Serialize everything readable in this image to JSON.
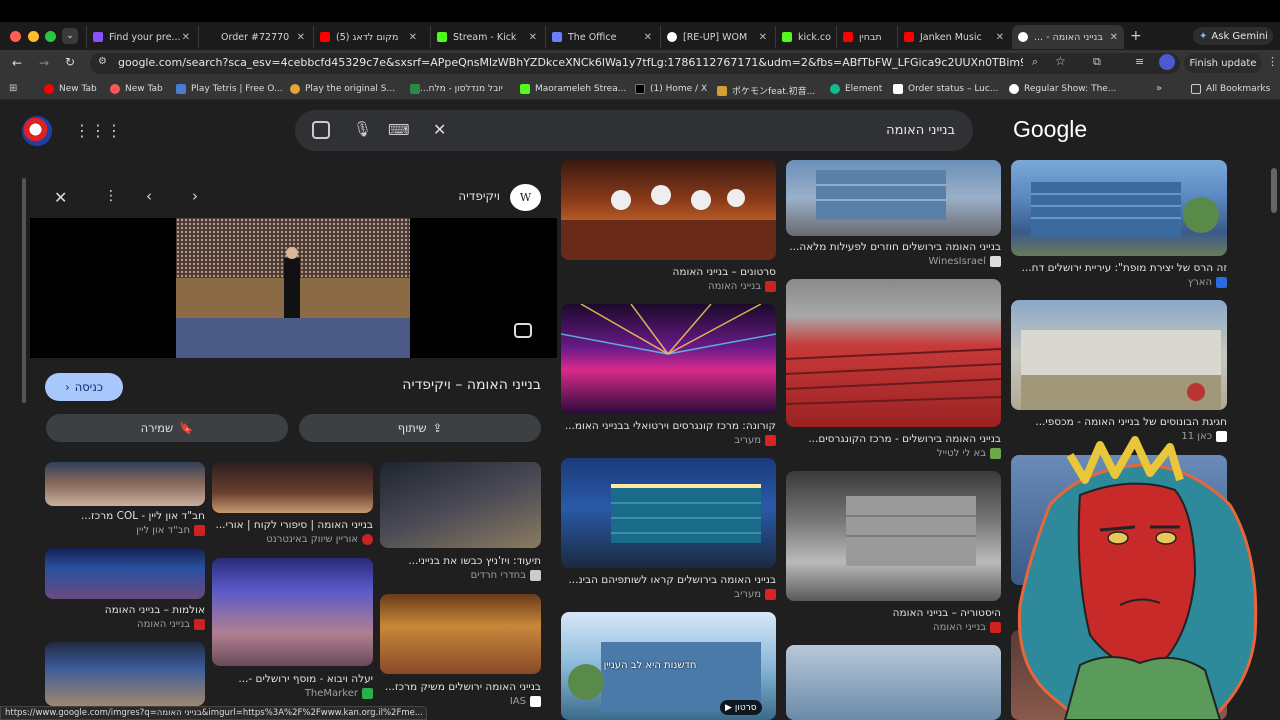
{
  "tabs": [
    {
      "label": "Find your pre..."
    },
    {
      "label": "Order #72770"
    },
    {
      "label": "(5) מקום לדאג"
    },
    {
      "label": "Stream - Kick"
    },
    {
      "label": "The Office"
    },
    {
      "label": "[RE-UP] WOM"
    },
    {
      "label": "kick.co"
    },
    {
      "label": "תבחין"
    },
    {
      "label": "Janken Music"
    },
    {
      "label": "בנייני האומה - ..."
    }
  ],
  "ask_gemini": "Ask Gemini",
  "url": "google.com/search?sca_esv=4cebbcfd45329c7e&sxsrf=APpeQnsMlzWBhYZDkceXNCk6lWa1y7tfLg:1786112767171&udm=2&fbs=ABfTbFW_LFGica9c2UUXn0TBim9XFWDbOu-YW...",
  "finish_update": "Finish update",
  "bookmarks": [
    "New Tab",
    "New Tab",
    "Play Tetris | Free O...",
    "Play the original S...",
    "יובל מנדלסון - מלח...",
    "Maorameleh Strea...",
    "(1) Home / X",
    "ポケモンfeat.初音...",
    "Element",
    "Order status – Luc...",
    "Regular Show: The..."
  ],
  "all_bookmarks": "All Bookmarks",
  "search": {
    "query": "בנייני האומה",
    "logo": "Google"
  },
  "panel": {
    "source": "ויקיפדיה",
    "title": "בנייני האומה – ויקיפדיה",
    "visit": "כניסה",
    "share": "שיתוף",
    "save": "שמירה",
    "related": [
      {
        "caption": "תיעוד: ויז'ניץ כבשו את בנייני...",
        "source": "בחדרי חרדים"
      },
      {
        "caption": "בנייני האומה | סיפורי לקוח | אורי...",
        "source": "אוריין שיווק באינטרנט"
      },
      {
        "caption": "חב\"ד און ליין - COL מרכז...",
        "source": "חב\"ד און ליין"
      },
      {
        "caption": "אולמות – בנייני האומה",
        "source": "בנייני האומה"
      },
      {
        "caption": "בנייני האומה ירושלים משיק מרכז...",
        "source": "IAS"
      },
      {
        "caption": "יעלה ויבוא - מוסף ירושלים -...",
        "source": "TheMarker"
      }
    ]
  },
  "grid": [
    {
      "caption": "זה הרס של יצירת מופת\": עיריית ירושלים דח...",
      "source": "הארץ"
    },
    {
      "caption": "חגיגת הבונוסים של בנייני האומה - מכספי...",
      "source": "כאן 11"
    },
    {
      "caption": "בנייני האומה בירושלים חוזרים לפעילות מלאה...",
      "source": "WinesIsrael"
    },
    {
      "caption": "בנייני האומה בירושלים - מרכז הקונגרסים...",
      "source": "בא לי לטייל"
    },
    {
      "caption": "היסטוריה – בנייני האומה",
      "source": "בנייני האומה"
    },
    {
      "caption": "סרטונים – בנייני האומה",
      "source": "בנייני האומה"
    },
    {
      "caption": "קורונה: מרכז קונגרסים וירטואלי בבנייני האומ...",
      "source": "מעריב"
    },
    {
      "caption": "בנייני האומה בירושלים קראו לשותפיהם הבינ...",
      "source": "מעריב"
    },
    {
      "caption": "חדשנות היא לב העניין",
      "source": "סרטון"
    }
  ],
  "status_url": "https://www.google.com/imgres?q=בנייני האומה&imgurl=https%3A%2F%2Fwww.kan.org.il%2Fme...",
  "colors": {
    "page_bg": "#1f1f1f",
    "accent_button": "#a8c7fa",
    "searchbox": "#303134",
    "tab_active": "#353535"
  }
}
